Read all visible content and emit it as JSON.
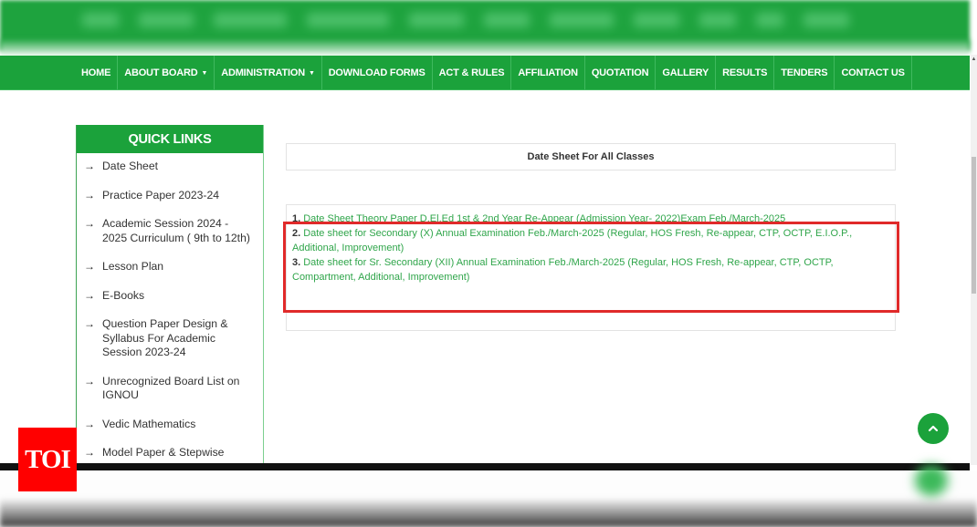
{
  "nav": {
    "items": [
      {
        "label": "HOME",
        "has_dropdown": false
      },
      {
        "label": "ABOUT BOARD",
        "has_dropdown": true
      },
      {
        "label": "ADMINISTRATION",
        "has_dropdown": true
      },
      {
        "label": "DOWNLOAD FORMS",
        "has_dropdown": false
      },
      {
        "label": "ACT & RULES",
        "has_dropdown": false
      },
      {
        "label": "AFFILIATION",
        "has_dropdown": false
      },
      {
        "label": "QUOTATION",
        "has_dropdown": false
      },
      {
        "label": "GALLERY",
        "has_dropdown": false
      },
      {
        "label": "RESULTS",
        "has_dropdown": false
      },
      {
        "label": "TENDERS",
        "has_dropdown": false
      },
      {
        "label": "CONTACT US",
        "has_dropdown": false
      }
    ],
    "caret": "▼"
  },
  "sidebar": {
    "title": "QUICK LINKS",
    "arrow": "→",
    "items": [
      {
        "label": "Date Sheet"
      },
      {
        "label": "Practice Paper 2023-24"
      },
      {
        "label": "Academic Session 2024 - 2025 Curriculum ( 9th to 12th)"
      },
      {
        "label": "Lesson Plan"
      },
      {
        "label": "E-Books"
      },
      {
        "label": "Question Paper Design & Syllabus For Academic Session 2023-24"
      },
      {
        "label": "Unrecognized Board List on IGNOU"
      },
      {
        "label": "Vedic Mathematics"
      },
      {
        "label": "Model Paper & Stepwise"
      }
    ]
  },
  "main": {
    "title": "Date Sheet For All Classes",
    "date_sheets": [
      {
        "num": "1.",
        "text": "Date Sheet Theory Paper D.El.Ed 1st & 2nd Year Re-Appear (Admission Year- 2022)Exam Feb./March-2025"
      },
      {
        "num": "2.",
        "text": "Date sheet for Secondary (X) Annual Examination Feb./March-2025 (Regular, HOS Fresh, Re-appear, CTP, OCTP, E.I.O.P., Additional, Improvement)"
      },
      {
        "num": "3.",
        "text": "Date sheet for Sr. Secondary (XII) Annual Examination Feb./March-2025 (Regular, HOS Fresh, Re-appear, CTP, OCTP, Compartment, Additional, Improvement)"
      }
    ]
  },
  "watermark": {
    "label": "TOI"
  },
  "colors": {
    "brand_green": "#1ba23b",
    "link_green": "#2fa54a",
    "highlight_red": "#e02a2a",
    "toi_red": "#ff0000"
  }
}
